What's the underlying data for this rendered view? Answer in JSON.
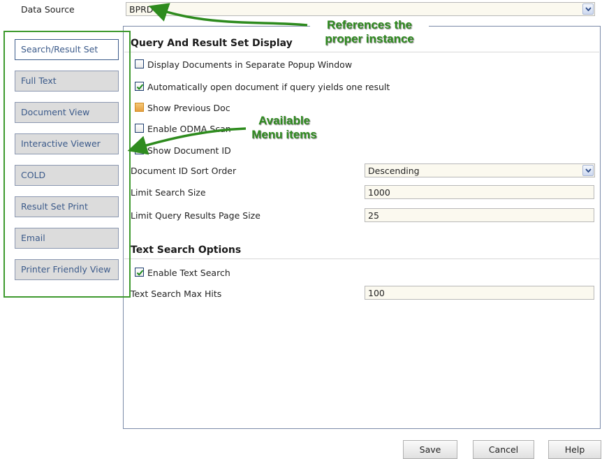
{
  "data_source": {
    "label": "Data Source",
    "value": "BPRD"
  },
  "sidebar": {
    "items": [
      {
        "label": "Search/Result Set",
        "active": true
      },
      {
        "label": "Full Text",
        "active": false
      },
      {
        "label": "Document View",
        "active": false
      },
      {
        "label": "Interactive Viewer",
        "active": false
      },
      {
        "label": "COLD",
        "active": false
      },
      {
        "label": "Result Set Print",
        "active": false
      },
      {
        "label": "Email",
        "active": false
      },
      {
        "label": "Printer Friendly View",
        "active": false
      }
    ]
  },
  "query_section": {
    "title": "Query And Result Set Display",
    "options": [
      {
        "label": "Display Documents in Separate Popup Window",
        "checked": false
      },
      {
        "label": "Automatically open document if query yields one result",
        "checked": true
      },
      {
        "label": "Show Previous Doc",
        "checked": false
      },
      {
        "label": "Enable ODMA Scan",
        "checked": false
      },
      {
        "label": "Show Document ID",
        "checked": false
      }
    ],
    "sort_order": {
      "label": "Document ID Sort Order",
      "value": "Descending"
    },
    "limit_search": {
      "label": "Limit Search Size",
      "value": "1000"
    },
    "limit_page": {
      "label": "Limit Query Results Page Size",
      "value": "25"
    }
  },
  "text_section": {
    "title": "Text Search Options",
    "enable": {
      "label": "Enable Text Search",
      "checked": true
    },
    "max_hits": {
      "label": "Text Search Max Hits",
      "value": "100"
    }
  },
  "buttons": {
    "save": "Save",
    "cancel": "Cancel",
    "help": "Help"
  },
  "callouts": {
    "instance": [
      "References the",
      "proper instance"
    ],
    "menu": [
      "Available",
      "Menu items"
    ]
  },
  "colors": {
    "callout_green": "#2e8b1e",
    "frame_green": "#3e9a2e",
    "tab_text": "#3b5a8a",
    "check": "#1a8a1a"
  }
}
